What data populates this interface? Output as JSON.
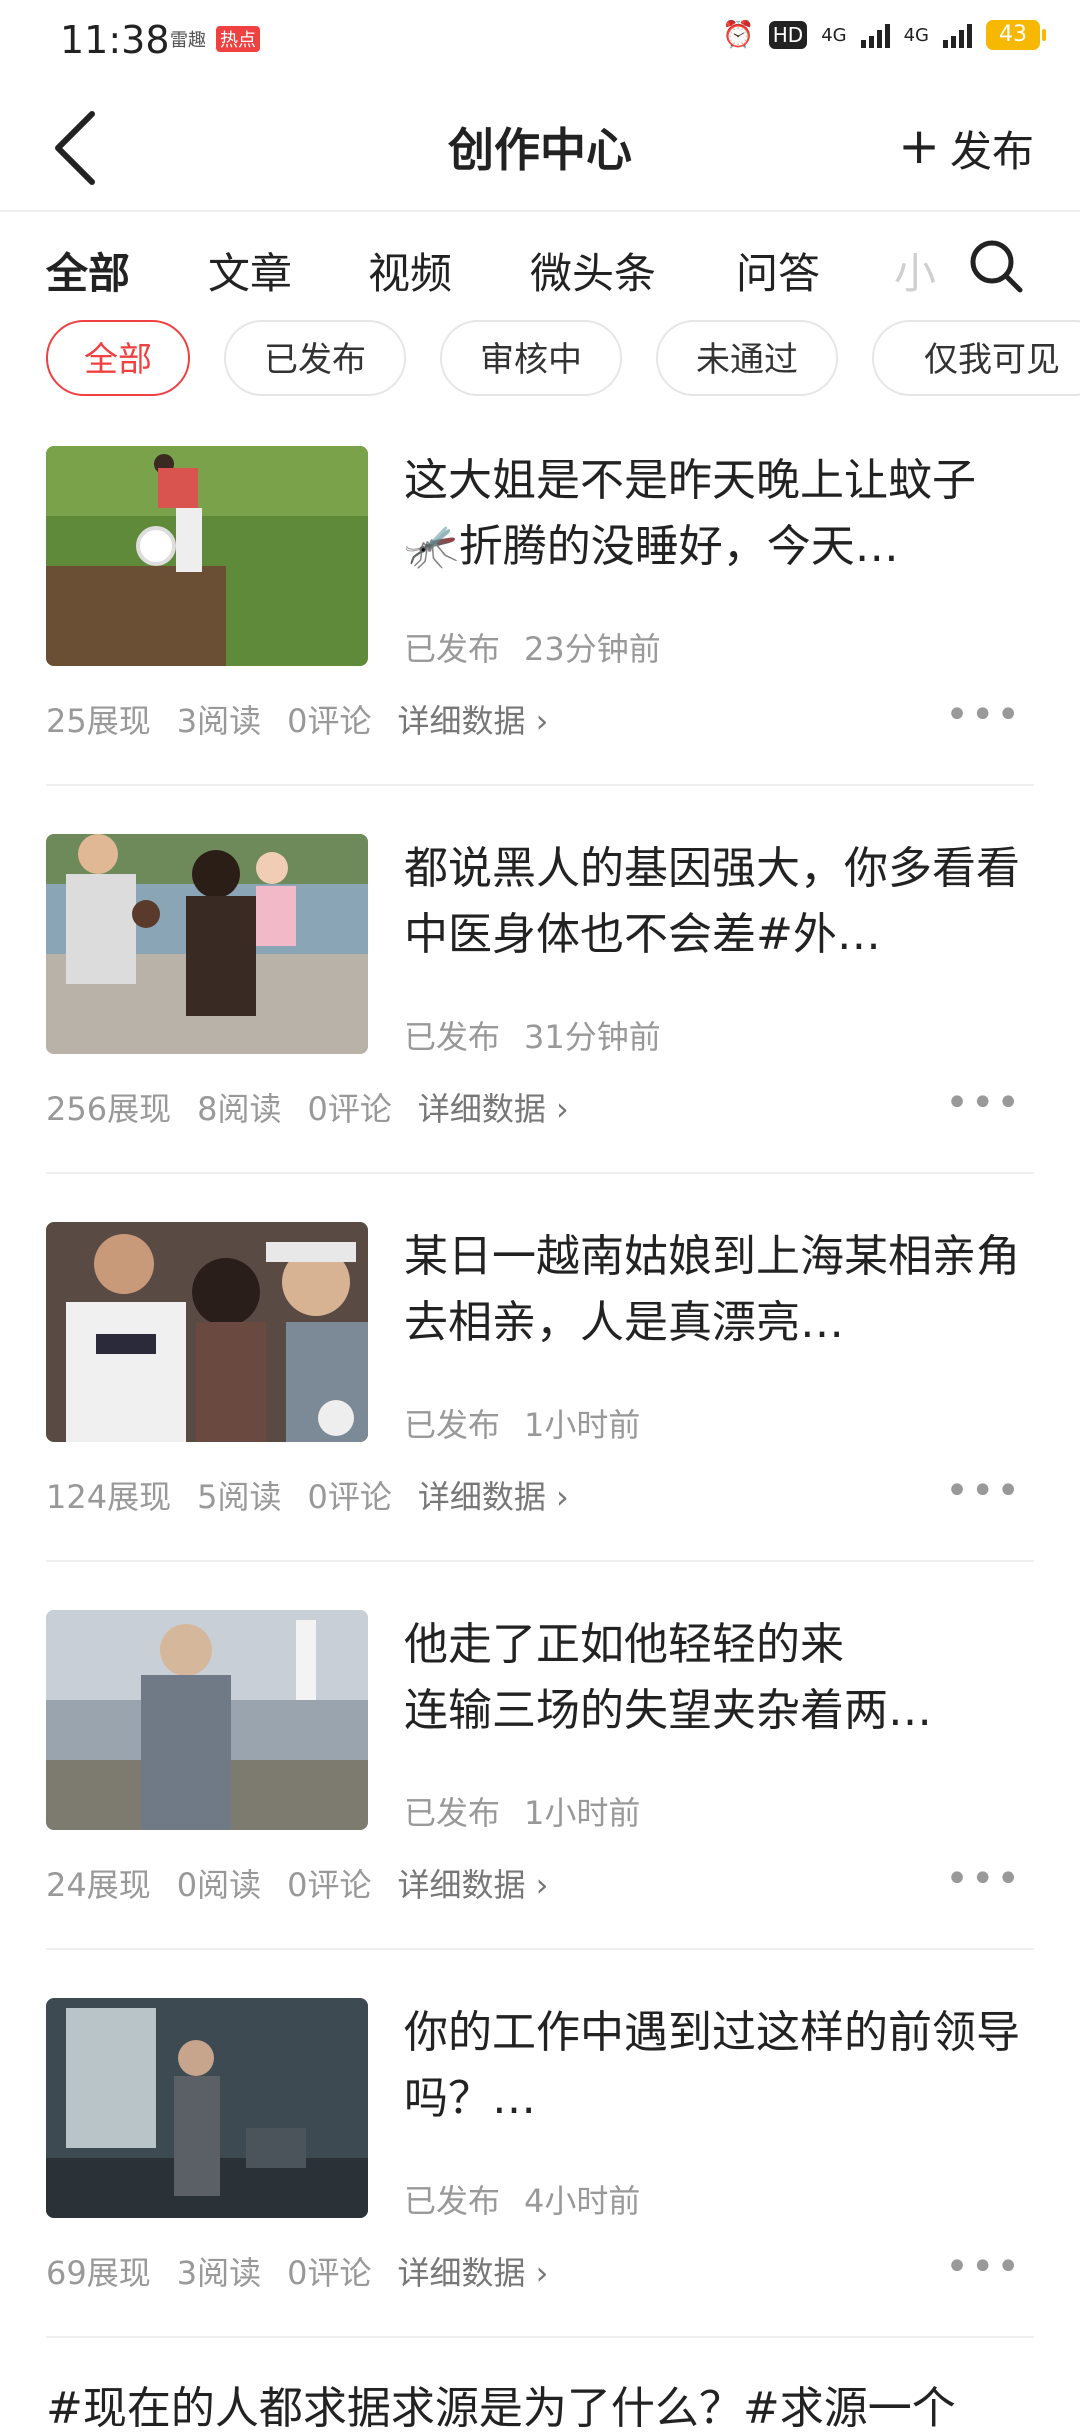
{
  "status_bar": {
    "time": "11:38",
    "mini_left": "雷趣",
    "mini_badge": "热点",
    "alarm_icon": "alarm-icon",
    "hd": "HD",
    "sim1": "4G",
    "sim2": "4G",
    "battery": "43"
  },
  "header": {
    "title": "创作中心",
    "publish_label": "发布"
  },
  "tabs": [
    "全部",
    "文章",
    "视频",
    "微头条",
    "问答",
    "小"
  ],
  "chips": [
    "全部",
    "已发布",
    "审核中",
    "未通过",
    "仅我可见"
  ],
  "items": [
    {
      "title": "这大姐是不是昨天晚上让蚊子🦟折腾的没睡好，今天…",
      "status": "已发布",
      "time": "23分钟前",
      "views": "25展现",
      "reads": "3阅读",
      "comments": "0评论",
      "detail": "详细数据"
    },
    {
      "title": "都说黑人的基因强大，你多看看中医身体也不会差#外…",
      "status": "已发布",
      "time": "31分钟前",
      "views": "256展现",
      "reads": "8阅读",
      "comments": "0评论",
      "detail": "详细数据"
    },
    {
      "title": "某日一越南姑娘到上海某相亲角去相亲，人是真漂亮…",
      "status": "已发布",
      "time": "1小时前",
      "views": "124展现",
      "reads": "5阅读",
      "comments": "0评论",
      "detail": "详细数据"
    },
    {
      "title": "他走了正如他轻轻的来\n连输三场的失望夹杂着两…",
      "status": "已发布",
      "time": "1小时前",
      "views": "24展现",
      "reads": "0阅读",
      "comments": "0评论",
      "detail": "详细数据"
    },
    {
      "title": "你的工作中遇到过这样的前领导吗？…",
      "status": "已发布",
      "time": "4小时前",
      "views": "69展现",
      "reads": "3阅读",
      "comments": "0评论",
      "detail": "详细数据"
    }
  ],
  "bottom_cut_text": "#现在的人都求据求源是为了什么？#求源一个"
}
